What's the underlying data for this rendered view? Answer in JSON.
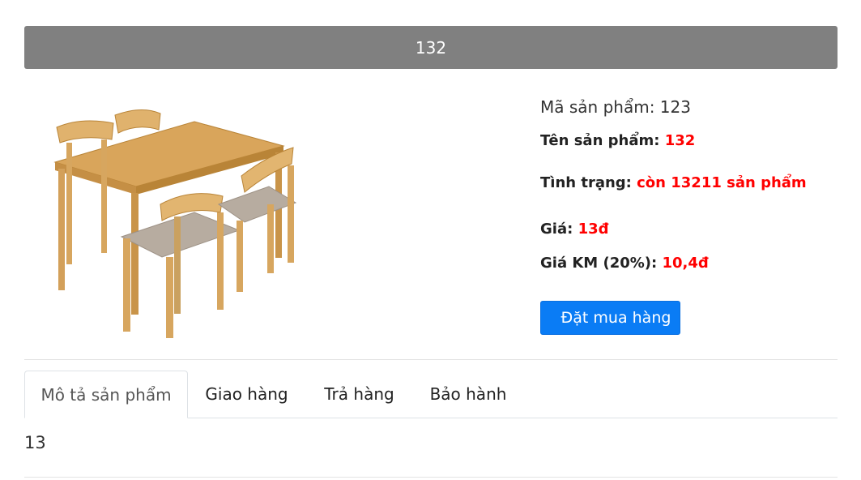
{
  "header": {
    "title": "132"
  },
  "product": {
    "image_icon": "dining-table-set-image",
    "sku_label": "Mã sản phẩm: ",
    "sku_value": "123",
    "name_label": "Tên sản phẩm: ",
    "name_value": "132",
    "stock_label": "Tình trạng: ",
    "stock_value": "còn 13211 sản phẩm",
    "price_label": "Giá: ",
    "price_value": "13đ",
    "sale_label": "Giá KM (20%): ",
    "sale_value": "10,4đ",
    "buy_label": "Đặt mua hàng"
  },
  "tabs": [
    {
      "label": "Mô tả sản phẩm"
    },
    {
      "label": "Giao hàng"
    },
    {
      "label": "Trả hàng"
    },
    {
      "label": "Bảo hành"
    }
  ],
  "description": {
    "text": "13"
  },
  "colors": {
    "header_bg": "#808080",
    "accent": "#0a7cf5",
    "highlight": "#ff0000"
  }
}
